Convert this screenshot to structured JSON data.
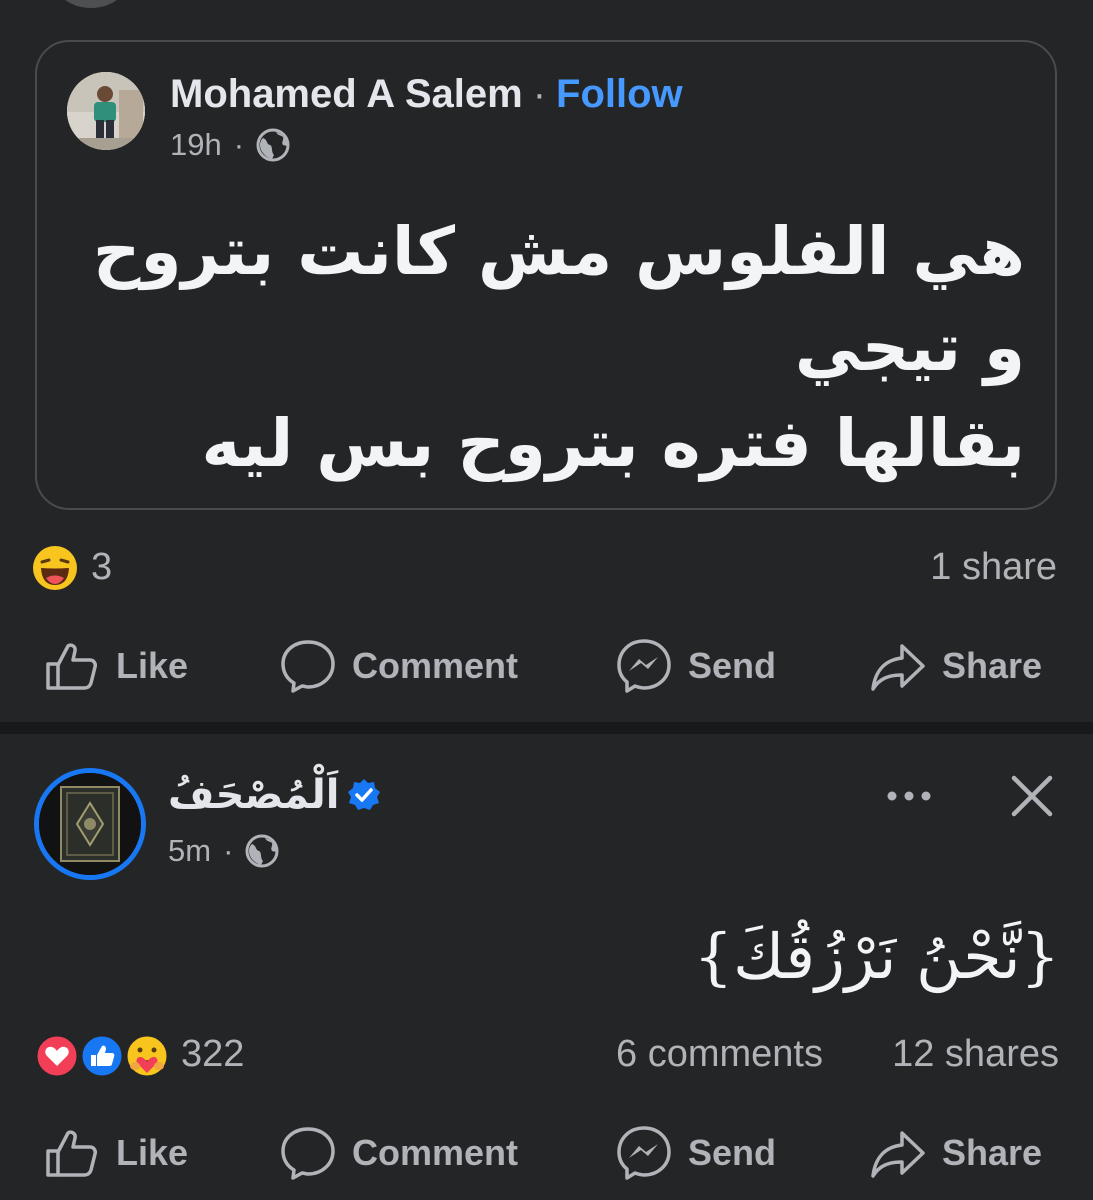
{
  "post1": {
    "author": "Mohamed A Salem",
    "separator": "·",
    "follow_label": "Follow",
    "time": "19h",
    "meta_separator": "·",
    "privacy_icon": "globe-icon",
    "text_line1": "هي الفلوس مش كانت بتروح و تيجي",
    "text_line2": "بقالها فتره بتروح بس ليه",
    "reaction_icon": "haha-emoji-icon",
    "reaction_count": "3",
    "shares": "1 share"
  },
  "actions": {
    "like": "Like",
    "comment": "Comment",
    "send": "Send",
    "share": "Share"
  },
  "post2": {
    "page_name": "اَلْمُصْحَفُ",
    "verified_icon": "verified-badge-icon",
    "time": "5m",
    "meta_separator": "·",
    "privacy_icon": "globe-icon",
    "text": "{نَّحْنُ نَرْزُقُكَ}",
    "reaction_icons": [
      "love-icon",
      "like-icon",
      "care-icon"
    ],
    "reaction_count": "322",
    "comments": "6 comments",
    "shares": "12 shares"
  },
  "colors": {
    "background": "#242526",
    "divider": "#18191a",
    "text_primary": "#e4e6eb",
    "text_secondary": "#b0b3b8",
    "follow_blue": "#4599ff",
    "verified_blue": "#1877f2"
  }
}
